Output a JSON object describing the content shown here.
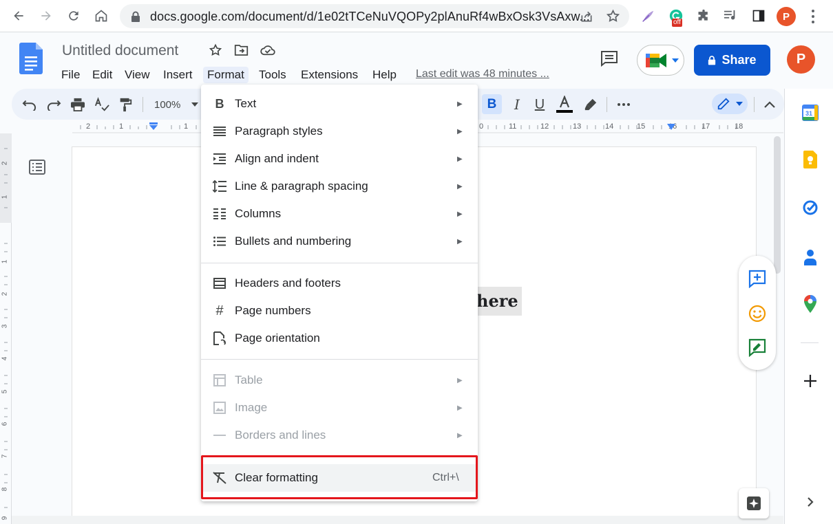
{
  "browser": {
    "url": "docs.google.com/document/d/1e02tTCeNuVQOPy2plAnuRf4wBxOsk3VsAxw...",
    "extension_badge": "off",
    "profile_initial": "P"
  },
  "doc": {
    "title": "Untitled document",
    "menu": [
      "File",
      "Edit",
      "View",
      "Insert",
      "Format",
      "Tools",
      "Extensions",
      "Help"
    ],
    "last_edit": "Last edit was 48 minutes ...",
    "share_label": "Share",
    "avatar_initial": "P"
  },
  "toolbar": {
    "zoom": "100%"
  },
  "ruler": {
    "numbers_left": [
      "2",
      "1",
      "1"
    ],
    "numbers_right": [
      "0",
      "11",
      "12",
      "13",
      "14",
      "15",
      "16",
      "17",
      "18"
    ]
  },
  "vruler": {
    "numbers": [
      "2",
      "1",
      "1",
      "2",
      "3",
      "4",
      "5",
      "6",
      "7",
      "8",
      "9"
    ]
  },
  "page": {
    "visible_text": "here"
  },
  "format_menu": {
    "items": [
      {
        "label": "Text",
        "icon": "bold-icon",
        "submenu": true,
        "disabled": false
      },
      {
        "label": "Paragraph styles",
        "icon": "paragraph-styles-icon",
        "submenu": true,
        "disabled": false
      },
      {
        "label": "Align and indent",
        "icon": "indent-icon",
        "submenu": true,
        "disabled": false
      },
      {
        "label": "Line & paragraph spacing",
        "icon": "line-spacing-icon",
        "submenu": true,
        "disabled": false
      },
      {
        "label": "Columns",
        "icon": "columns-icon",
        "submenu": true,
        "disabled": false
      },
      {
        "label": "Bullets and numbering",
        "icon": "bulleted-list-icon",
        "submenu": true,
        "disabled": false
      },
      {
        "label": "Headers and footers",
        "icon": "header-footer-icon",
        "submenu": false,
        "disabled": false
      },
      {
        "label": "Page numbers",
        "icon": "hash-icon",
        "submenu": false,
        "disabled": false
      },
      {
        "label": "Page orientation",
        "icon": "page-orientation-icon",
        "submenu": false,
        "disabled": false
      },
      {
        "label": "Table",
        "icon": "table-icon",
        "submenu": true,
        "disabled": true
      },
      {
        "label": "Image",
        "icon": "image-icon",
        "submenu": true,
        "disabled": true
      },
      {
        "label": "Borders and lines",
        "icon": "border-line-icon",
        "submenu": true,
        "disabled": true
      },
      {
        "label": "Clear formatting",
        "icon": "clear-formatting-icon",
        "submenu": false,
        "disabled": false,
        "shortcut": "Ctrl+\\"
      }
    ]
  },
  "colors": {
    "accent": "#0b57d0",
    "highlight_box": "#e4161c",
    "avatar": "#e8542a"
  }
}
